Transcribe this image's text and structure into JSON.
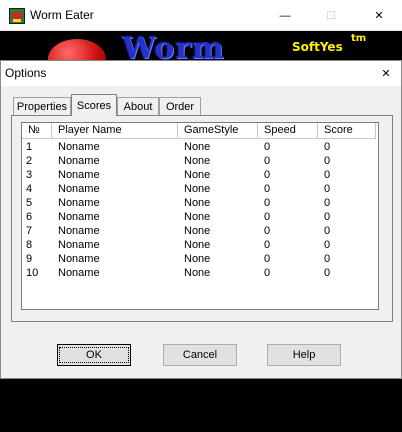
{
  "main_window": {
    "title": "Worm Eater",
    "icon": "worm-eater-app-icon",
    "controls": {
      "minimize": "—",
      "maximize": "☐",
      "close": "✕"
    }
  },
  "banner": {
    "title": "Worm",
    "brand": "SoftYes",
    "tm": "tm"
  },
  "dialog": {
    "title": "Options",
    "close": "✕",
    "tabs": [
      {
        "label": "Properties",
        "active": false
      },
      {
        "label": "Scores",
        "active": true
      },
      {
        "label": "About",
        "active": false
      },
      {
        "label": "Order",
        "active": false
      }
    ],
    "scores": {
      "columns": [
        "№",
        "Player Name",
        "GameStyle",
        "Speed",
        "Score"
      ],
      "rows": [
        [
          "1",
          "Noname",
          "None",
          "0",
          "0"
        ],
        [
          "2",
          "Noname",
          "None",
          "0",
          "0"
        ],
        [
          "3",
          "Noname",
          "None",
          "0",
          "0"
        ],
        [
          "4",
          "Noname",
          "None",
          "0",
          "0"
        ],
        [
          "5",
          "Noname",
          "None",
          "0",
          "0"
        ],
        [
          "6",
          "Noname",
          "None",
          "0",
          "0"
        ],
        [
          "7",
          "Noname",
          "None",
          "0",
          "0"
        ],
        [
          "8",
          "Noname",
          "None",
          "0",
          "0"
        ],
        [
          "9",
          "Noname",
          "None",
          "0",
          "0"
        ],
        [
          "10",
          "Noname",
          "None",
          "0",
          "0"
        ]
      ]
    },
    "buttons": {
      "ok": "OK",
      "cancel": "Cancel",
      "help": "Help"
    }
  }
}
